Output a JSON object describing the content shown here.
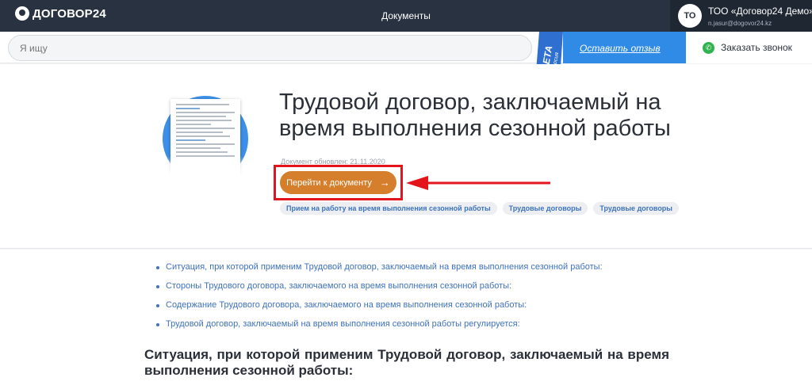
{
  "header": {
    "logo_text": "ДОГОВОР24",
    "nav_title": "Документы",
    "account": {
      "avatar_initials": "ТО",
      "name": "ТОО «Договор24 Демо»",
      "email": "n.jasur@dogovor24.kz"
    }
  },
  "search": {
    "placeholder": "Я ищу"
  },
  "beta": {
    "label": "БЕТА",
    "sublabel": "версия",
    "color": "#2f6fcf"
  },
  "feedback": {
    "label": "Оставить отзыв"
  },
  "callback": {
    "label": "Заказать звонок",
    "icon": "phone-icon",
    "icon_color": "#2fb34e"
  },
  "document": {
    "title": "Трудовой договор, заключаемый на время выполнения сезонной работы",
    "updated": "Документ обновлен: 21.11.2020",
    "go_button_label": "Перейти к документу",
    "go_button_color": "#d57f2c",
    "highlight_color": "#e3141b",
    "tags": [
      "Прием на работу на время выполнения сезонной работы",
      "Трудовые договоры",
      "Трудовые договоры"
    ]
  },
  "toc": [
    "Ситуация, при которой применим Трудовой договор, заключаемый на время выполнения сезонной работы:",
    "Стороны Трудового договора, заключаемого на время выполнения сезонной работы:",
    "Содержание Трудового договора, заключаемого на время выполнения сезонной работы:",
    "Трудовой договор, заключаемый на время выполнения сезонной работы регулируется:"
  ],
  "section_heading": "Ситуация, при которой применим Трудовой договор, заключаемый на время выполнения сезонной работы:"
}
